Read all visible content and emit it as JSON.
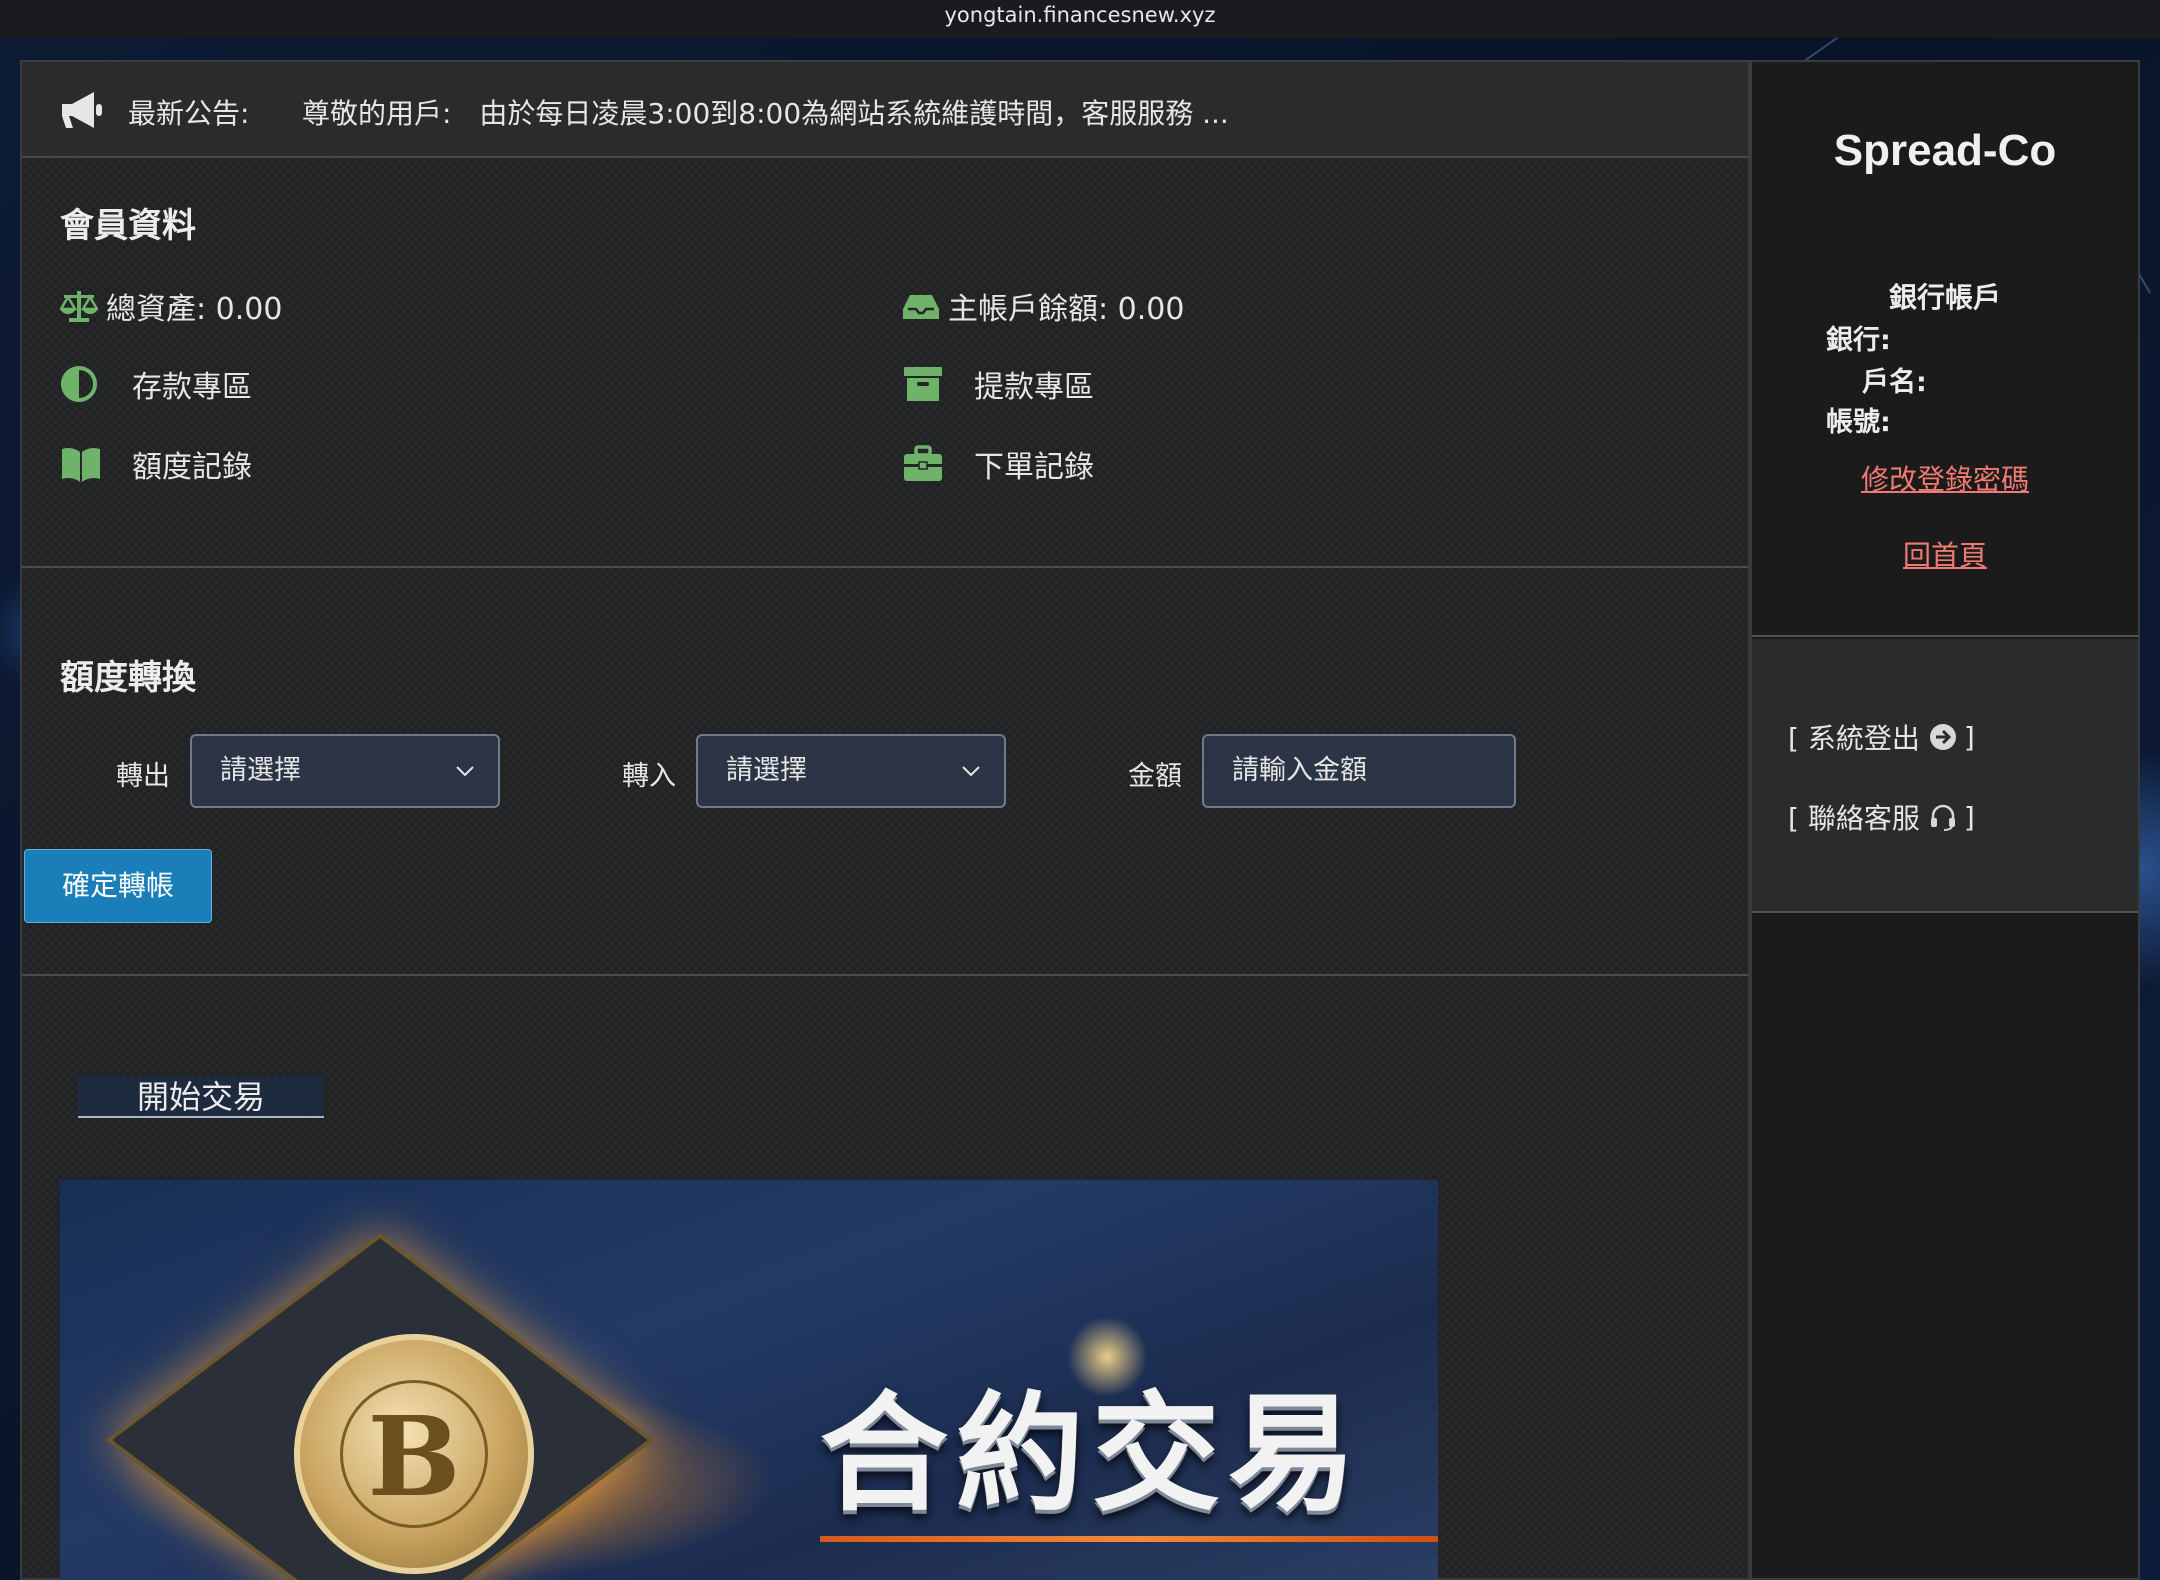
{
  "browser": {
    "url": "yongtain.financesnew.xyz"
  },
  "notice": {
    "label": "最新公告:",
    "text": "尊敬的用戶:　由於每日凌晨3:00到8:00為網站系統維護時間，客服服務 ..."
  },
  "member": {
    "title": "會員資料",
    "total_assets": "總資產: 0.00",
    "main_balance": "主帳戶餘額: 0.00",
    "menu": {
      "deposit": "存款專區",
      "withdraw": "提款專區",
      "quota_records": "額度記錄",
      "order_records": "下單記錄"
    }
  },
  "transfer": {
    "title": "額度轉換",
    "out_label": "轉出",
    "out_value": "請選擇",
    "in_label": "轉入",
    "in_value": "請選擇",
    "amount_label": "金額",
    "amount_placeholder": "請輸入金額",
    "confirm_button": "確定轉帳"
  },
  "trade": {
    "tab_label": "開始交易",
    "banner_title": "合約交易",
    "banner_coin_symbol": "B"
  },
  "sidebar": {
    "brand": "Spread-Co",
    "bank_title": "銀行帳戶",
    "bank_label": "銀行:",
    "name_label": "戶名:",
    "account_label": "帳號:",
    "change_password": "修改登錄密碼",
    "home": "回首頁",
    "logout": "[ 系統登出",
    "logout_close": "]",
    "support": "[ 聯絡客服",
    "support_close": "]"
  },
  "colors": {
    "icon_green": "#6fb36a",
    "accent_blue": "#1a7fb8",
    "link_red": "#f07a72"
  }
}
